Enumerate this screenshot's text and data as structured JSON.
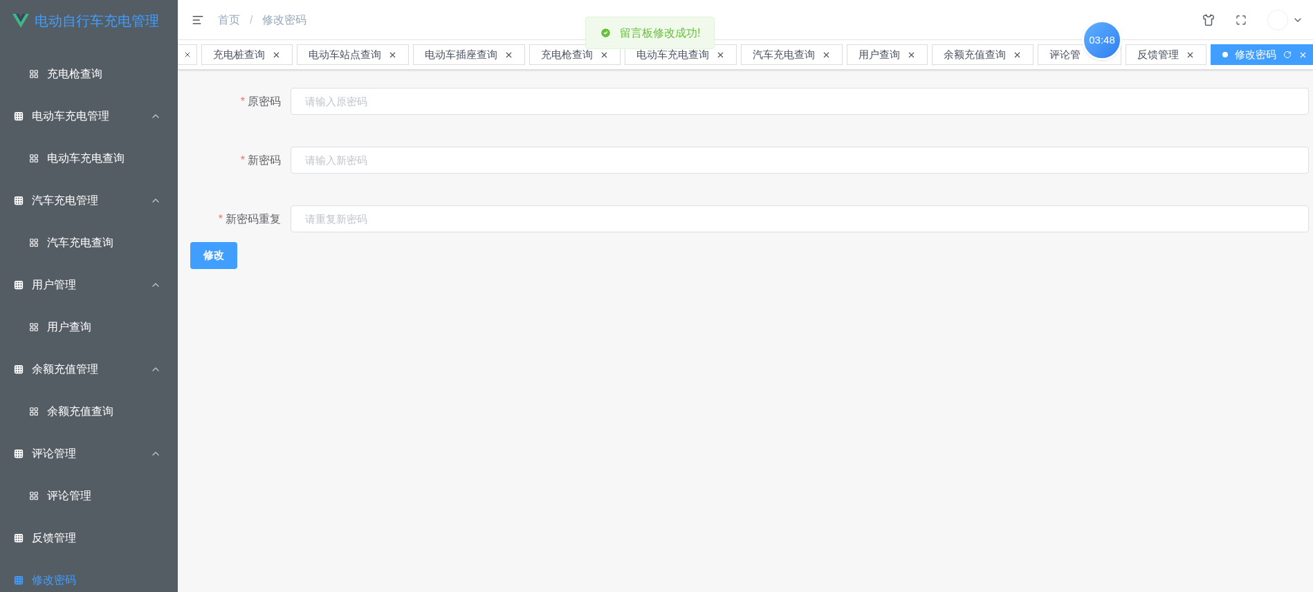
{
  "app_title": "电动自行车充电管理",
  "sidebar": {
    "items": [
      {
        "kind": "sub",
        "label": "充电枪查询",
        "selected": false
      },
      {
        "kind": "group",
        "label": "电动车充电管理",
        "expanded": true,
        "selected": false,
        "children": [
          {
            "kind": "sub",
            "label": "电动车充电查询",
            "selected": false
          }
        ]
      },
      {
        "kind": "group",
        "label": "汽车充电管理",
        "expanded": true,
        "selected": false,
        "children": [
          {
            "kind": "sub",
            "label": "汽车充电查询",
            "selected": false
          }
        ]
      },
      {
        "kind": "group",
        "label": "用户管理",
        "expanded": true,
        "selected": false,
        "children": [
          {
            "kind": "sub",
            "label": "用户查询",
            "selected": false
          }
        ]
      },
      {
        "kind": "group",
        "label": "余额充值管理",
        "expanded": true,
        "selected": false,
        "children": [
          {
            "kind": "sub",
            "label": "余额充值查询",
            "selected": false
          }
        ]
      },
      {
        "kind": "group",
        "label": "评论管理",
        "expanded": true,
        "selected": false,
        "children": [
          {
            "kind": "sub",
            "label": "评论管理",
            "selected": false
          }
        ]
      },
      {
        "kind": "item",
        "label": "反馈管理",
        "selected": false
      },
      {
        "kind": "item",
        "label": "修改密码",
        "selected": true
      }
    ]
  },
  "breadcrumb": [
    "首页",
    "修改密码"
  ],
  "breadcrumb_separator": "/",
  "required_mark": "*",
  "tabs": [
    {
      "label": "充电桩查询",
      "selected": false
    },
    {
      "label": "电动车站点查询",
      "selected": false
    },
    {
      "label": "电动车插座查询",
      "selected": false
    },
    {
      "label": "充电枪查询",
      "selected": false
    },
    {
      "label": "电动车充电查询",
      "selected": false
    },
    {
      "label": "汽车充电查询",
      "selected": false
    },
    {
      "label": "用户查询",
      "selected": false
    },
    {
      "label": "余额充值查询",
      "selected": false
    },
    {
      "label": "评论管",
      "selected": false,
      "closable": false
    },
    {
      "label": "反馈管理",
      "selected": false
    },
    {
      "label": "修改密码",
      "selected": true
    }
  ],
  "toast": {
    "message": "留言板修改成功!"
  },
  "timer": "03:48",
  "form": {
    "fields": [
      {
        "label": "原密码",
        "required": true,
        "placeholder": "请输入原密码"
      },
      {
        "label": "新密码",
        "required": true,
        "placeholder": "请输入新密码"
      },
      {
        "label": "新密码重复",
        "required": true,
        "placeholder": "请重复新密码"
      }
    ],
    "submit": "修改"
  }
}
